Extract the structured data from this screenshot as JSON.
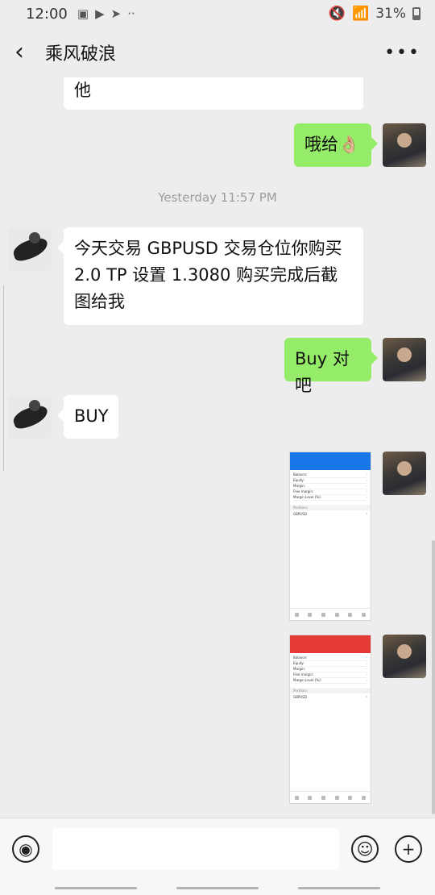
{
  "status_bar": {
    "time": "12:00",
    "battery": "31%",
    "icons": [
      "gallery-icon",
      "youtube-icon",
      "telegram-icon",
      "more-dots-icon",
      "mute-icon",
      "wifi-icon",
      "signal-icon",
      "battery-icon"
    ]
  },
  "header": {
    "title": "乘风破浪",
    "back_icon": "chevron-left-icon",
    "more_icon": "more-horizontal-icon"
  },
  "messages": [
    {
      "side": "left",
      "type": "text",
      "text": "他"
    },
    {
      "side": "right",
      "type": "text",
      "text": "哦给👌🏼"
    },
    {
      "type": "timestamp",
      "text": "Yesterday 11:57 PM"
    },
    {
      "side": "left",
      "type": "text",
      "text": "今天交易 GBPUSD  交易仓位你购买 2.0  TP 设置 1.3080  购买完成后截图给我"
    },
    {
      "side": "right",
      "type": "text",
      "text": "Buy 对吧"
    },
    {
      "side": "left",
      "type": "text",
      "text": "BUY"
    },
    {
      "side": "right",
      "type": "image",
      "theme": "blue",
      "header_color": "#1976e8"
    },
    {
      "side": "right",
      "type": "image",
      "theme": "red",
      "header_color": "#e53935"
    }
  ],
  "input_bar": {
    "placeholder": "",
    "voice_icon": "voice-icon",
    "emoji_icon": "emoji-icon",
    "add_icon": "plus-icon"
  },
  "colors": {
    "background": "#ededed",
    "my_bubble": "#95ec69",
    "their_bubble": "#ffffff"
  }
}
